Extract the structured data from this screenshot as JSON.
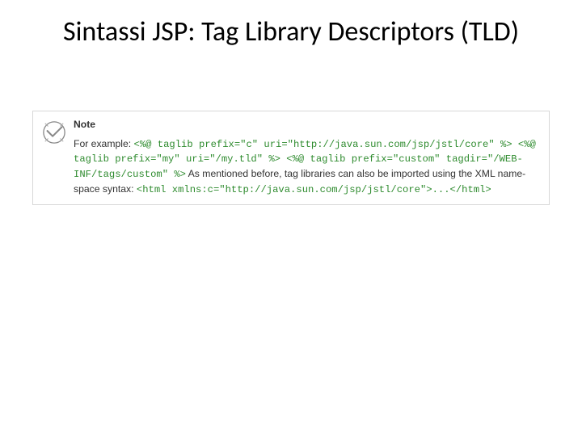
{
  "title": "Sintassi JSP: Tag Library Descriptors (TLD)",
  "note": {
    "label": "Note",
    "text1": "For example: ",
    "code1": "<%@ taglib prefix=\"c\" uri=\"http://java.sun.com/jsp/jstl/core\" %> <%@ taglib prefix=\"my\" uri=\"/my.tld\" %> <%@ taglib prefix=\"custom\" tagdir=\"/WEB-INF/tags/custom\" %>",
    "text2": " As mentioned before, tag libraries can also be imported using the XML name-space syntax: ",
    "code2": "<html xmlns:c=\"http://java.sun.com/jsp/jstl/core\">...</html>"
  }
}
